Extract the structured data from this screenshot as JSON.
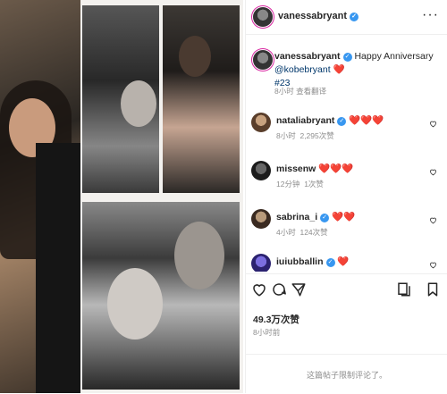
{
  "post": {
    "author": "vanessabryant",
    "more_icon": "more-horizontal-icon"
  },
  "caption": {
    "username": "vanessabryant",
    "text": "Happy Anniversary",
    "mention": "@kobebryant",
    "hearts": "❤️",
    "hashtag": "#23",
    "time": "8小时",
    "translate": "查看翻译"
  },
  "comments": [
    {
      "username": "nataliabryant",
      "text": "❤️❤️❤️",
      "time": "8小时",
      "likes": "2,295次赞",
      "verified": true
    },
    {
      "username": "missenw",
      "text": "❤️❤️❤️",
      "time": "12分钟",
      "likes": "1次赞",
      "verified": false
    },
    {
      "username": "sabrina_i",
      "text": "❤️❤️",
      "time": "4小时",
      "likes": "124次赞",
      "verified": true
    },
    {
      "username": "iuiubballin",
      "text": "❤️",
      "time": "",
      "likes": "",
      "verified": true
    }
  ],
  "actions": {
    "like_icon": "heart-icon",
    "comment_icon": "comment-icon",
    "share_icon": "share-icon",
    "save_icon": "bookmark-icon"
  },
  "likes_count": "49.3万次赞",
  "post_time": "8小时前",
  "footer_text": "这篇帖子限制评论了。",
  "colors": {
    "verified": "#3897f0",
    "heart": "#ed1c24",
    "muted": "#8e8e8e"
  }
}
